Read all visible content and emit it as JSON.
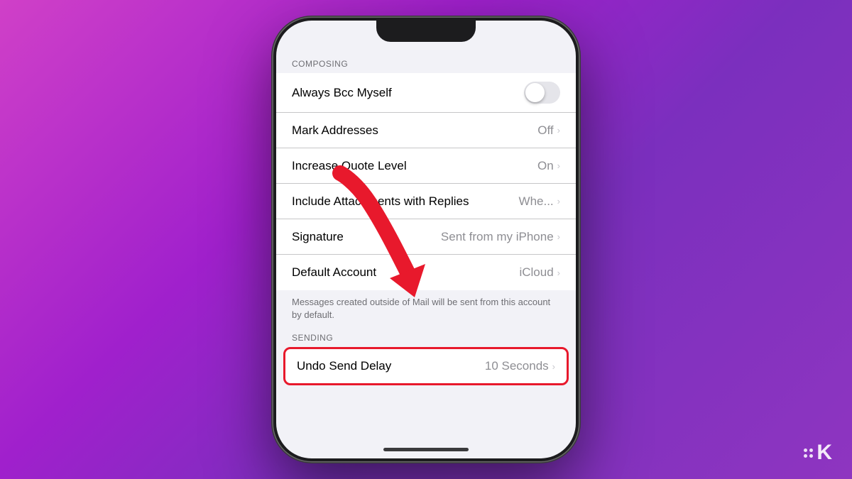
{
  "background": {
    "gradient_start": "#c850c0",
    "gradient_end": "#7b2fbe"
  },
  "phone": {
    "sections": [
      {
        "id": "composing",
        "header": "COMPOSING",
        "rows": [
          {
            "id": "always-bcc",
            "label": "Always Bcc Myself",
            "value": "",
            "type": "toggle",
            "toggle_on": false
          },
          {
            "id": "mark-addresses",
            "label": "Mark Addresses",
            "value": "Off",
            "type": "navigate"
          },
          {
            "id": "increase-quote",
            "label": "Increase Quote Level",
            "value": "On",
            "type": "navigate"
          },
          {
            "id": "include-attachments",
            "label": "Include Attachments with Replies",
            "value": "Whe...",
            "type": "navigate"
          },
          {
            "id": "signature",
            "label": "Signature",
            "value": "Sent from my iPhone",
            "type": "navigate"
          },
          {
            "id": "default-account",
            "label": "Default Account",
            "value": "iCloud",
            "type": "navigate"
          }
        ],
        "footer": "Messages created outside of Mail will be sent from this account by default."
      },
      {
        "id": "sending",
        "header": "SENDING",
        "rows": [
          {
            "id": "undo-send-delay",
            "label": "Undo Send Delay",
            "value": "10 Seconds",
            "type": "navigate",
            "highlighted": true
          }
        ]
      }
    ],
    "logo": {
      "text": "K",
      "prefix_dots": true
    }
  }
}
